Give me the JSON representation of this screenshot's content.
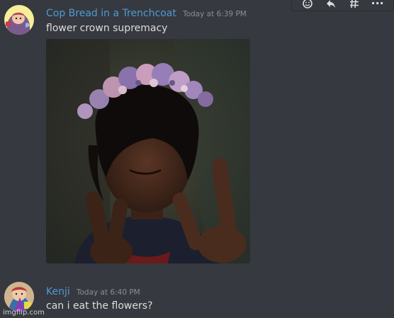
{
  "toolbar": {
    "icons": [
      "add-reaction-icon",
      "reply-icon",
      "hashtag-icon",
      "more-icon"
    ],
    "more_label": "···"
  },
  "messages": [
    {
      "username": "Cop Bread in a Trenchcoat",
      "timestamp": "Today at 6:39 PM",
      "text": "flower crown supremacy",
      "has_image": true
    },
    {
      "username": "Kenji",
      "timestamp": "Today at 6:40 PM",
      "text": "can i eat the flowers?"
    }
  ],
  "watermark": "imgflip.com",
  "colors": {
    "background": "#36393f",
    "username": "#4e9ad6",
    "text": "#dcddde",
    "timestamp": "#8a8e94"
  }
}
